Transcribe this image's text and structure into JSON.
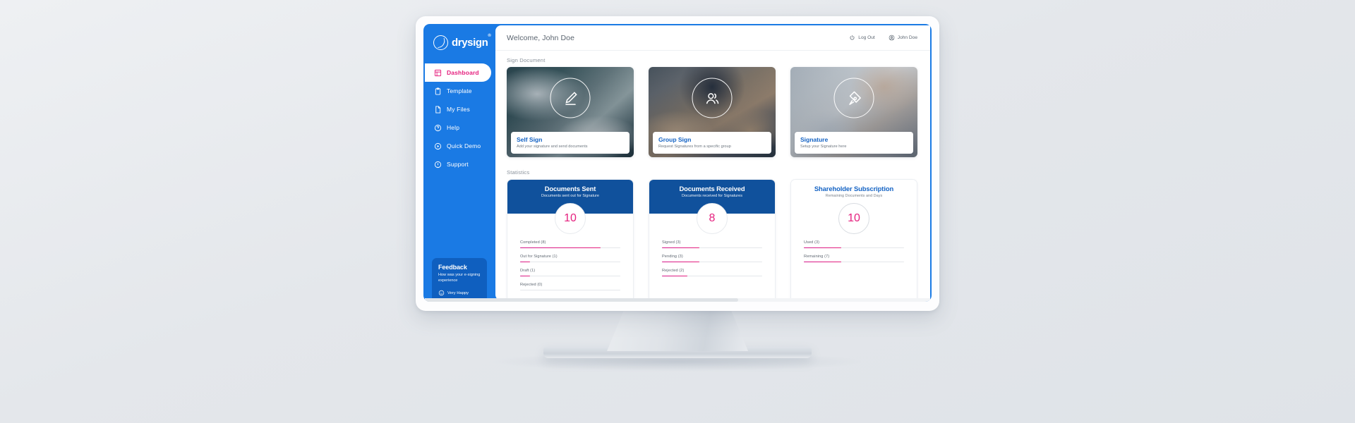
{
  "brand": {
    "name": "drysign",
    "trademark": "®"
  },
  "sidebar": {
    "items": [
      {
        "label": "Dashboard",
        "icon": "dashboard-icon",
        "active": true
      },
      {
        "label": "Template",
        "icon": "clipboard-icon",
        "active": false
      },
      {
        "label": "My Files",
        "icon": "file-icon",
        "active": false
      },
      {
        "label": "Help",
        "icon": "question-icon",
        "active": false
      },
      {
        "label": "Quick Demo",
        "icon": "play-icon",
        "active": false
      },
      {
        "label": "Support",
        "icon": "info-icon",
        "active": false
      }
    ],
    "feedback": {
      "title": "Feedback",
      "subtitle": "How was your e-signing experience",
      "rating_label": "Very Happy",
      "rating_icon": "smiley-icon"
    }
  },
  "topbar": {
    "welcome": "Welcome, John Doe",
    "logout_label": "Log Out",
    "logout_icon": "power-icon",
    "user_label": "John Doe",
    "user_icon": "user-circle-icon"
  },
  "sign_section": {
    "label": "Sign Document",
    "cards": [
      {
        "title": "Self Sign",
        "subtitle": "Add your signature and send documents",
        "icon": "pen-signature-icon"
      },
      {
        "title": "Group Sign",
        "subtitle": "Request Signatures from a specific group",
        "icon": "group-users-icon"
      },
      {
        "title": "Signature",
        "subtitle": "Setup your Signature here",
        "icon": "fountain-pen-icon"
      }
    ]
  },
  "statistics_section": {
    "label": "Statistics",
    "cards": [
      {
        "title": "Documents Sent",
        "subtitle": "Documents sent out for Signature",
        "total": "10",
        "style": "filled",
        "bars": [
          {
            "label": "Completed (8)",
            "percent": 80
          },
          {
            "label": "Out for Signature (1)",
            "percent": 10
          },
          {
            "label": "Draft (1)",
            "percent": 10
          },
          {
            "label": "Rejected (0)",
            "percent": 0
          }
        ]
      },
      {
        "title": "Documents Received",
        "subtitle": "Documents received for Signatures",
        "total": "8",
        "style": "filled",
        "bars": [
          {
            "label": "Signed (3)",
            "percent": 37
          },
          {
            "label": "Pending (3)",
            "percent": 37
          },
          {
            "label": "Rejected (2)",
            "percent": 25
          }
        ]
      },
      {
        "title": "Shareholder Subscription",
        "subtitle": "Remaining Documents and Days",
        "total": "10",
        "style": "plain",
        "bars": [
          {
            "label": "Used (3)",
            "percent": 37
          },
          {
            "label": "Remaining (7)",
            "percent": 37
          }
        ]
      }
    ]
  },
  "colors": {
    "sidebar_blue": "#1a7ae4",
    "header_blue": "#10519c",
    "accent_pink": "#e5207e",
    "link_blue": "#1463c4",
    "feedback_blue": "#0f5fbf"
  }
}
